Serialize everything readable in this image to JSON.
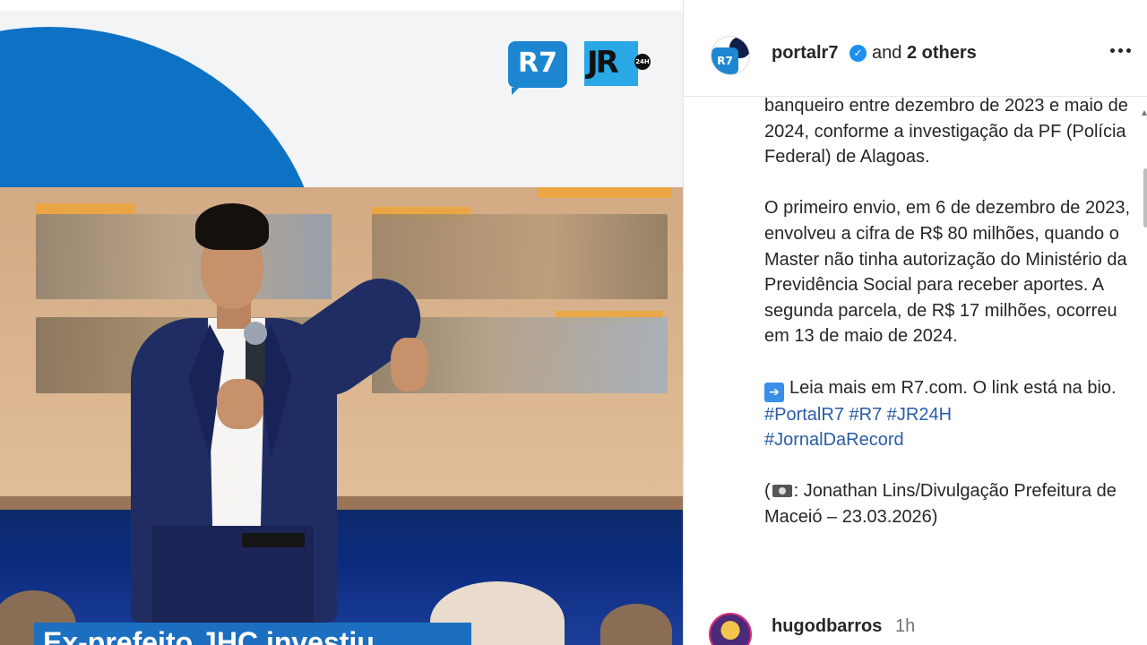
{
  "media": {
    "logo_primary": "R7",
    "logo_secondary": "JR",
    "logo_secondary_badge": "24H",
    "caption_overlay": "Ex-prefeito JHC investiu",
    "colors": {
      "brand_blue": "#0d72c4",
      "caption_blue": "#1c6fc0"
    }
  },
  "post": {
    "author": "portalr7",
    "coauthors_prefix": "and",
    "coauthors_count": "2 others",
    "body_paragraphs": [
      "banqueiro entre dezembro de 2023 e maio de 2024, conforme a investigação da PF (Polícia Federal) de Alagoas.",
      "O primeiro envio, em 6 de dezembro de 2023, envolveu a cifra de R$ 80 milhões, quando o Master não tinha autorização do Ministério da Previdência Social para receber aportes. A segunda parcela, de R$ 17 milhões, ocorreu em 13 de maio de 2024."
    ],
    "read_more": "Leia mais em R7.com. O link está na bio.",
    "hashtags": [
      "#PortalR7",
      "#R7",
      "#JR24H",
      "#JornalDaRecord"
    ],
    "credit_prefix": "(",
    "credit": ": Jonathan Lins/Divulgação Prefeitura de Maceió – 23.03.2026)"
  },
  "comment": {
    "username": "hugodbarros",
    "time": "1h"
  },
  "icons": {
    "verified": "verified-badge-icon",
    "more": "more-options-icon",
    "arrow": "right-arrow-emoji-icon",
    "camera": "camera-emoji-icon"
  }
}
